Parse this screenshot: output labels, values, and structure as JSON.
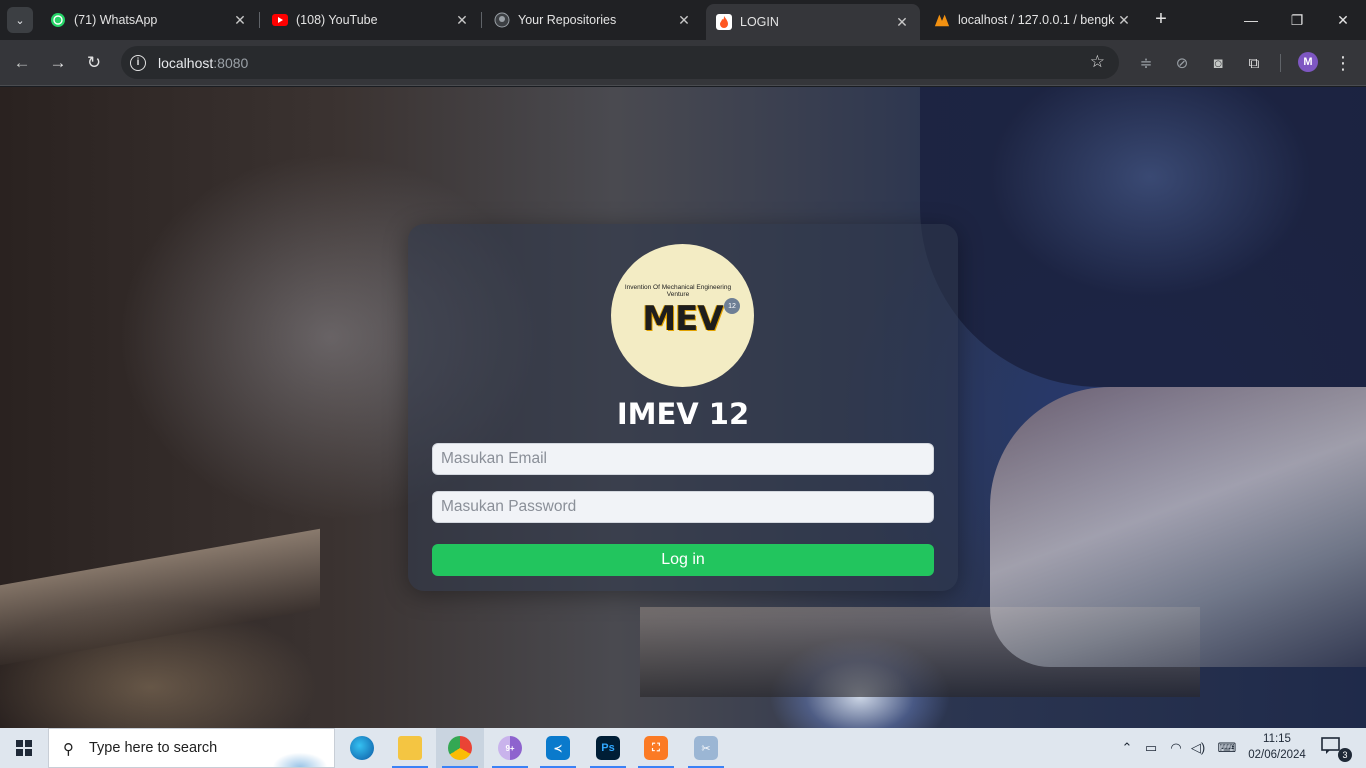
{
  "browser": {
    "tabs": [
      {
        "title": "(71) WhatsApp",
        "icon": "whatsapp-icon",
        "color": "#25d366"
      },
      {
        "title": "(108) YouTube",
        "icon": "youtube-icon",
        "color": "#ff0000"
      },
      {
        "title": "Your Repositories",
        "icon": "github-icon",
        "color": "#e3e3e3"
      },
      {
        "title": "LOGIN",
        "icon": "flame-icon",
        "color": "#ff7043",
        "active": true
      },
      {
        "title": "localhost / 127.0.0.1 / bengk",
        "icon": "phpmyadmin-icon",
        "color": "#f29111"
      }
    ],
    "url_host": "localhost",
    "url_port": ":8080",
    "profile_initial": "M"
  },
  "login": {
    "logo_subtitle": "Invention Of Mechanical Engineering Venture",
    "logo_text": "MEV",
    "logo_badge": "12",
    "title": "IMEV 12",
    "email_placeholder": "Masukan Email",
    "password_placeholder": "Masukan Password",
    "submit_label": "Log in",
    "accent_color": "#22c55e"
  },
  "taskbar": {
    "search_placeholder": "Type here to search",
    "apps": [
      "edge",
      "file-explorer",
      "chrome",
      "chrome-canary",
      "vscode",
      "photoshop",
      "xampp",
      "snipping-tool"
    ],
    "chrome_canary_badge": "9+",
    "time": "11:15",
    "date": "02/06/2024",
    "notification_count": "3"
  }
}
